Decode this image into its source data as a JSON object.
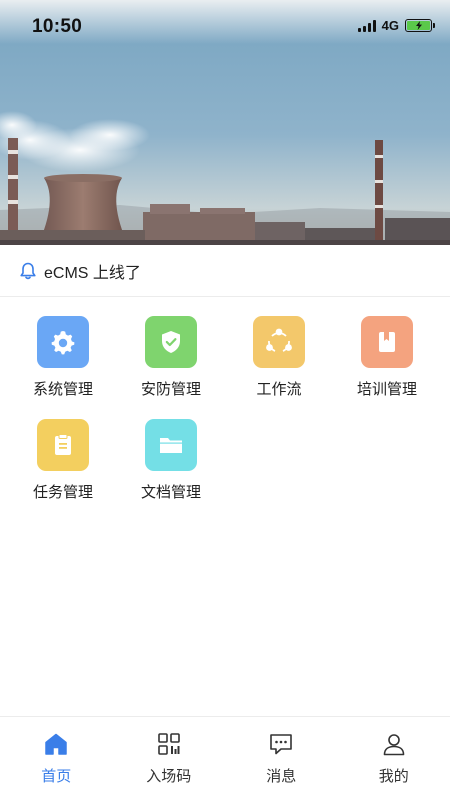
{
  "status_bar": {
    "time": "10:50",
    "network": "4G",
    "battery_color": "#5ac94a"
  },
  "hero": {
    "image": "industrial-skyline-banner"
  },
  "notice": {
    "icon": "bell-icon",
    "text": "eCMS 上线了",
    "icon_color": "#3a7ee8"
  },
  "modules": [
    {
      "label": "系统管理",
      "icon": "gear-icon",
      "color": "#6aa7f5"
    },
    {
      "label": "安防管理",
      "icon": "shield-check-icon",
      "color": "#7fd46e"
    },
    {
      "label": "工作流",
      "icon": "workflow-icon",
      "color": "#f3c86b"
    },
    {
      "label": "培训管理",
      "icon": "book-icon",
      "color": "#f4a37f"
    },
    {
      "label": "任务管理",
      "icon": "clipboard-icon",
      "color": "#f3cf5f"
    },
    {
      "label": "文档管理",
      "icon": "folder-icon",
      "color": "#74dfe6"
    }
  ],
  "tabs": [
    {
      "label": "首页",
      "icon": "home-icon",
      "active": true
    },
    {
      "label": "入场码",
      "icon": "qr-code-icon",
      "active": false
    },
    {
      "label": "消息",
      "icon": "message-icon",
      "active": false
    },
    {
      "label": "我的",
      "icon": "user-icon",
      "active": false
    }
  ],
  "theme": {
    "accent": "#3a7ee8",
    "tab_inactive": "#333333"
  }
}
